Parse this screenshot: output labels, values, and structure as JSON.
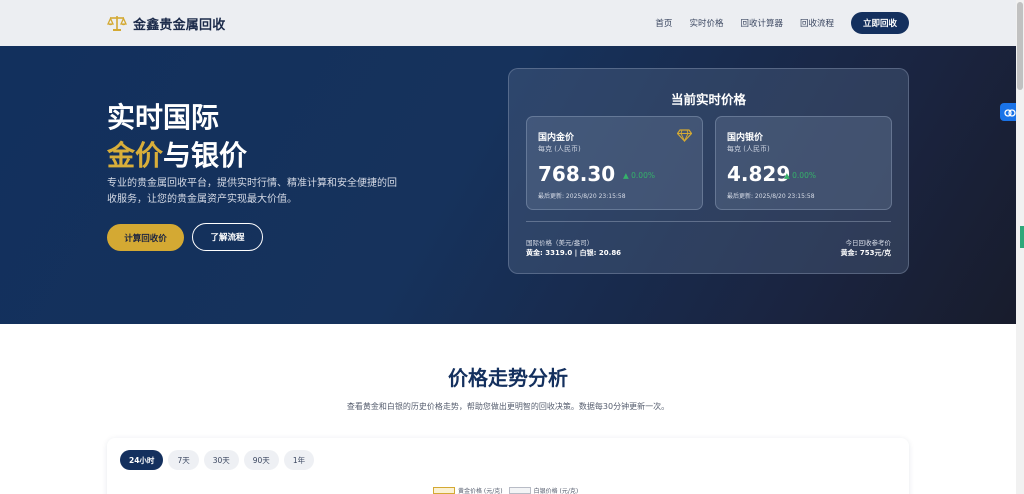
{
  "header": {
    "brand": "金鑫贵金属回收",
    "nav": [
      "首页",
      "实时价格",
      "回收计算器",
      "回收流程"
    ],
    "cta": "立即回收"
  },
  "hero": {
    "title_line1": "实时国际",
    "title_gold": "金价",
    "title_rest": "与银价",
    "description": "专业的贵金属回收平台，提供实时行情、精准计算和安全便捷的回收服务，让您的贵金属资产实现最大价值。",
    "primary_button": "计算回收价",
    "secondary_button": "了解流程"
  },
  "price_panel": {
    "title": "当前实时价格",
    "gold": {
      "name": "国内金价",
      "unit": "每克 (人民币)",
      "value": "768.30",
      "change": "▲ 0.00%",
      "updated": "最后更新: 2025/8/20 23:15:58"
    },
    "silver": {
      "name": "国内银价",
      "unit": "每克 (人民币)",
      "value": "4.829",
      "change": "▲ 0.00%",
      "updated": "最后更新: 2025/8/20 23:15:58"
    },
    "intl_label": "国际价格（美元/盎司）",
    "intl_value": "黄金: 3319.0 | 白银: 20.86",
    "ref_label": "今日回收参考价",
    "ref_value": "黄金: 753元/克"
  },
  "trend": {
    "title": "价格走势分析",
    "description": "查看黄金和白银的历史价格走势，帮助您做出更明智的回收决策。数据每30分钟更新一次。",
    "tabs": [
      "24小时",
      "7天",
      "30天",
      "90天",
      "1年"
    ],
    "active_tab": "24小时",
    "legend": [
      "黄金价格 (元/克)",
      "白银价格 (元/克)"
    ]
  },
  "colors": {
    "brand_navy": "#14305e",
    "gold_accent": "#d4a933",
    "positive_green": "#35b26a"
  },
  "icons": {
    "logo": "balance-scale-icon",
    "gold_card": "diamond-icon",
    "side_widget": "cloud-icon"
  }
}
